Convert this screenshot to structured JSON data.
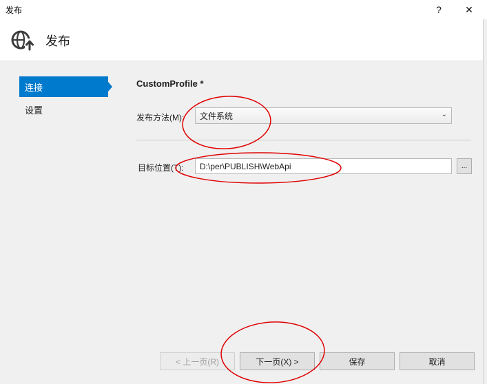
{
  "window": {
    "title": "发布",
    "help": "?",
    "close": "✕"
  },
  "header": {
    "icon": "globe-publish-icon",
    "title": "发布"
  },
  "nav": {
    "items": [
      {
        "label": "连接",
        "selected": true
      },
      {
        "label": "设置",
        "selected": false
      }
    ]
  },
  "content": {
    "profile_title": "CustomProfile *",
    "method_label": "发布方法(M):",
    "method_value": "文件系统",
    "target_label": "目标位置(T):",
    "target_value": "D:\\per\\PUBLISH\\WebApi",
    "browse_label": "..."
  },
  "footer": {
    "prev_label": "< 上一页(R)",
    "next_label": "下一页(X) >",
    "save_label": "保存",
    "cancel_label": "取消"
  },
  "colors": {
    "accent": "#007acc",
    "annotation": "#e00000"
  }
}
